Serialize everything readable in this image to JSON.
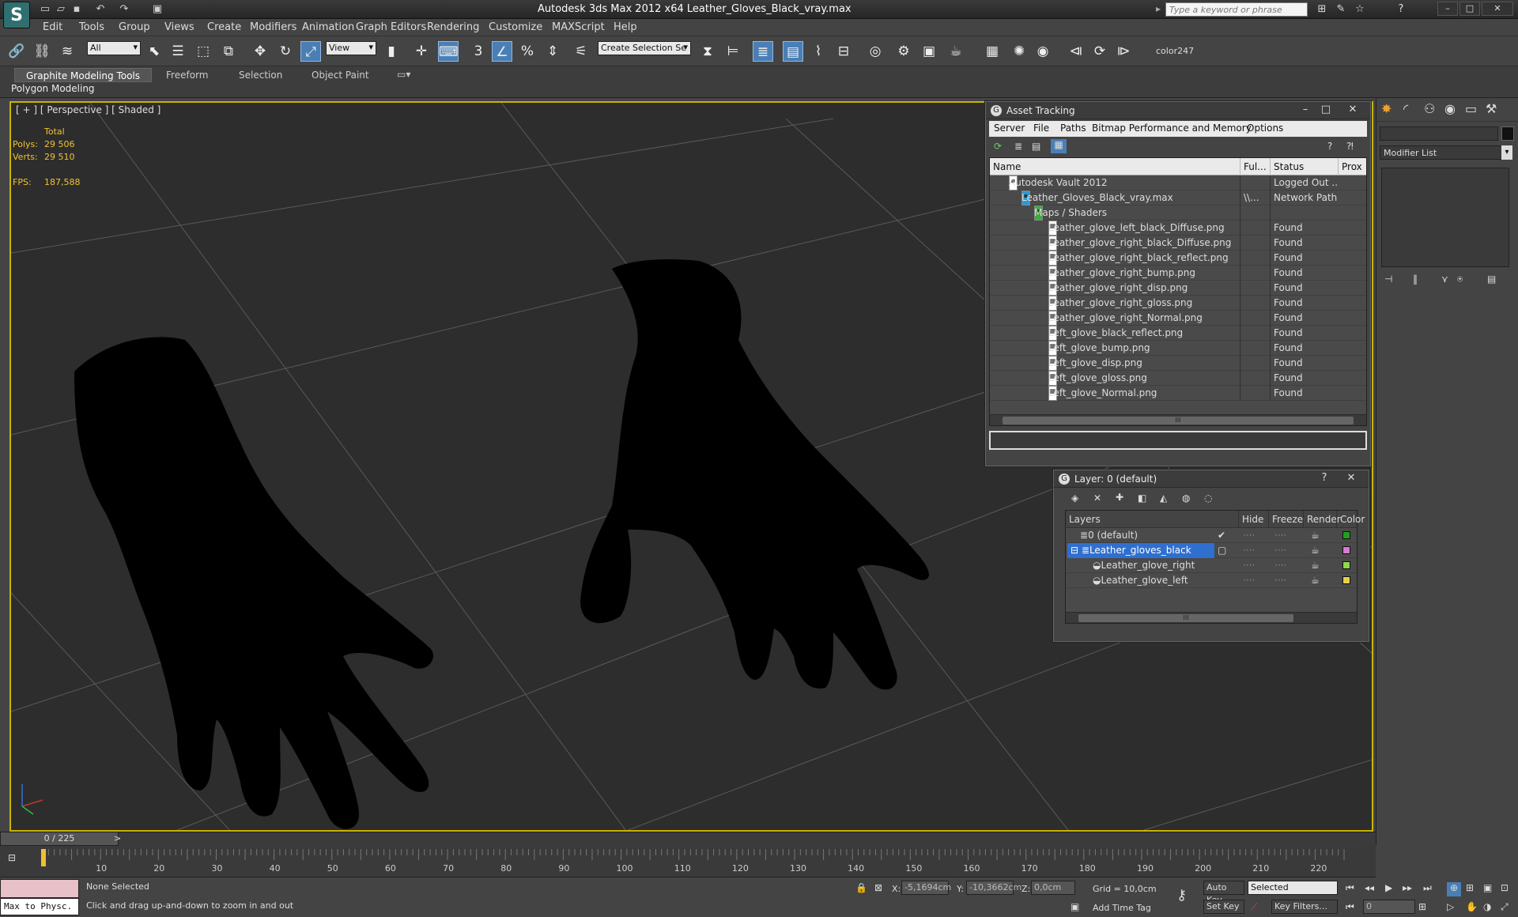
{
  "app": {
    "logo": "S",
    "title": "Autodesk 3ds Max  2012 x64      Leather_Gloves_Black_vray.max",
    "search_placeholder": "Type a keyword or phrase"
  },
  "menu": [
    "Edit",
    "Tools",
    "Group",
    "Views",
    "Create",
    "Modifiers",
    "Animation",
    "Graph Editors",
    "Rendering",
    "Customize",
    "MAXScript",
    "Help"
  ],
  "toolbar": {
    "selection_filter": "All",
    "ref_coord": "View",
    "named_selection": "Create Selection Se",
    "snap_label": "3",
    "color_label": "color247"
  },
  "ribbon": {
    "tabs": [
      "Graphite Modeling Tools",
      "Freeform",
      "Selection",
      "Object Paint"
    ],
    "panel": "Polygon Modeling"
  },
  "viewport": {
    "label": "[ + ] [ Perspective ] [ Shaded ]",
    "total_label": "Total",
    "polys_label": "Polys:",
    "polys": "29 506",
    "verts_label": "Verts:",
    "verts": "29 510",
    "fps_label": "FPS:",
    "fps": "187,588"
  },
  "asset_tracking": {
    "title": "Asset Tracking",
    "menu": [
      "Server",
      "File",
      "Paths",
      "Bitmap Performance and Memory",
      "Options"
    ],
    "columns": [
      "Name",
      "Ful...",
      "Status",
      "Prox"
    ],
    "rows": [
      {
        "name": "Autodesk Vault 2012",
        "full": "",
        "status": "Logged Out ..."
      },
      {
        "name": "Leather_Gloves_Black_vray.max",
        "full": "\\\\...",
        "status": "Network Path"
      },
      {
        "name": "Maps / Shaders",
        "full": "",
        "status": ""
      },
      {
        "name": "Leather_glove_left_black_Diffuse.png",
        "full": "",
        "status": "Found"
      },
      {
        "name": "Leather_glove_right_black_Diffuse.png",
        "full": "",
        "status": "Found"
      },
      {
        "name": "Leather_glove_right_black_reflect.png",
        "full": "",
        "status": "Found"
      },
      {
        "name": "Leather_glove_right_bump.png",
        "full": "",
        "status": "Found"
      },
      {
        "name": "Leather_glove_right_disp.png",
        "full": "",
        "status": "Found"
      },
      {
        "name": "Leather_glove_right_gloss.png",
        "full": "",
        "status": "Found"
      },
      {
        "name": "Leather_glove_right_Normal.png",
        "full": "",
        "status": "Found"
      },
      {
        "name": "Left_glove_black_reflect.png",
        "full": "",
        "status": "Found"
      },
      {
        "name": "Left_glove_bump.png",
        "full": "",
        "status": "Found"
      },
      {
        "name": "Left_glove_disp.png",
        "full": "",
        "status": "Found"
      },
      {
        "name": "Left_glove_gloss.png",
        "full": "",
        "status": "Found"
      },
      {
        "name": "Left_glove_Normal.png",
        "full": "",
        "status": "Found"
      }
    ]
  },
  "layer": {
    "title": "Layer: 0 (default)",
    "columns": [
      "Layers",
      "Hide",
      "Freeze",
      "Render",
      "Color"
    ],
    "rows": [
      {
        "name": "0 (default)",
        "color": "#1fa01f"
      },
      {
        "name": "Leather_gloves_black",
        "color": "#d67ad6"
      },
      {
        "name": "Leather_glove_right",
        "color": "#8ed84a"
      },
      {
        "name": "Leather_glove_left",
        "color": "#e6d24a"
      }
    ]
  },
  "command_panel": {
    "modifier_list": "Modifier List"
  },
  "timeline": {
    "frame": "0 / 225",
    "ticks": [
      "10",
      "20",
      "30",
      "40",
      "50",
      "60",
      "70",
      "80",
      "90",
      "100",
      "110",
      "120",
      "130",
      "140",
      "150",
      "160",
      "170",
      "180",
      "190",
      "200",
      "210",
      "220"
    ]
  },
  "status": {
    "script_listener": "Max to Physc.",
    "selection": "None Selected",
    "prompt": "Click and drag up-and-down to zoom in and out",
    "x_label": "X:",
    "x": "-5,1694cm",
    "y_label": "Y:",
    "y": "-10,3662cm",
    "z_label": "Z:",
    "z": "0,0cm",
    "grid": "Grid = 10,0cm",
    "auto_key": "Auto Key",
    "selected": "Selected",
    "set_key": "Set Key",
    "key_filters": "Key Filters...",
    "add_time_tag": "Add Time Tag",
    "frame_field": "0"
  }
}
